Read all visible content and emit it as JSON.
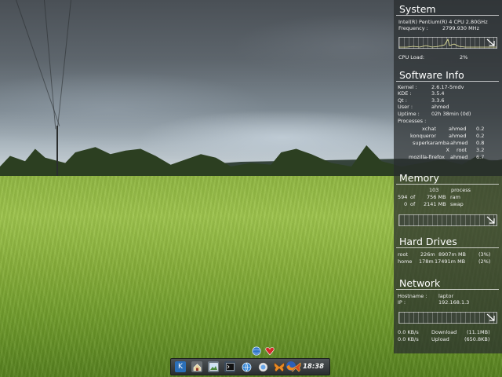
{
  "system": {
    "title": "System",
    "cpu_model": "Intel(R) Pentium(R) 4 CPU 2.80GHz",
    "frequency_label": "Frequency :",
    "frequency_value": "2799.930  MHz",
    "cpu_load_label": "CPU Load:",
    "cpu_load_value": "2%"
  },
  "software": {
    "title": "Software Info",
    "kernel_label": "Kernel :",
    "kernel_value": "2.6.17-5mdv",
    "kde_label": "KDE :",
    "kde_value": "3.5.4",
    "qt_label": "Qt :",
    "qt_value": "3.3.6",
    "user_label": "User :",
    "user_value": "ahmed",
    "uptime_label": "Uptime :",
    "uptime_value": "02h 38min (0d)",
    "processes_label": "Processes :",
    "processes": [
      {
        "name": "xchat",
        "user": "ahmed",
        "cpu": "0.2"
      },
      {
        "name": "konqueror",
        "user": "ahmed",
        "cpu": "0.2"
      },
      {
        "name": "superkaramba",
        "user": "ahmed",
        "cpu": "0.8"
      },
      {
        "name": "X",
        "user": "root",
        "cpu": "3.2"
      },
      {
        "name": "mozilla-firefox",
        "user": "ahmed",
        "cpu": "6.7"
      }
    ]
  },
  "memory": {
    "title": "Memory",
    "process_count": "103",
    "process_label": "process",
    "ram_used": "594",
    "ram_of": "of",
    "ram_total": "756 MB",
    "ram_label": "ram",
    "swap_used": "0",
    "swap_of": "of",
    "swap_total": "2141 MB",
    "swap_label": "swap"
  },
  "drives": {
    "title": "Hard Drives",
    "items": [
      {
        "name": "root",
        "used": "226m",
        "total": "8907m MB",
        "percent": "(3%)",
        "fraction": 0.03
      },
      {
        "name": "home",
        "used": "178m",
        "total": "17491m MB",
        "percent": "(2%)",
        "fraction": 0.02
      }
    ]
  },
  "network": {
    "title": "Network",
    "hostname_label": "Hostname :",
    "hostname_value": "laptor",
    "ip_label": "IP :",
    "ip_value": "192.168.1.3",
    "down_rate": "0.0 KB/s",
    "down_label": "Download",
    "down_total": "(11.1MB)",
    "up_rate": "0.0 KB/s",
    "up_label": "Upload",
    "up_total": "(650.8KB)"
  },
  "taskbar": {
    "clock": "18:38",
    "items": [
      "kmenu-icon",
      "home-folder-icon",
      "image-viewer-icon",
      "terminal-icon",
      "network-icon",
      "bug-icon",
      "butterfly-icon",
      "messenger-icon",
      "firefox-icon"
    ]
  },
  "colors": {
    "panel": "#282c2e",
    "field": "#8fb542",
    "sky": "#5d656c"
  }
}
